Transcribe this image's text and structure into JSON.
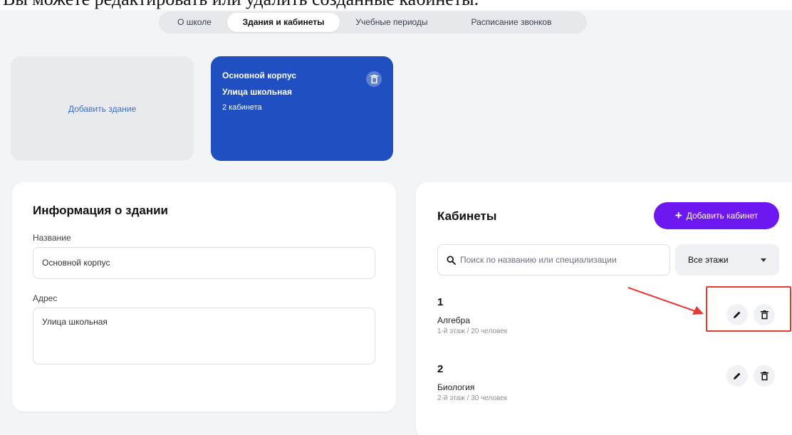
{
  "caption": "Вы можете редактировать или удалить созданные кабинеты.",
  "tabs": [
    {
      "label": "О школе",
      "active": false
    },
    {
      "label": "Здания и кабинеты",
      "active": true
    },
    {
      "label": "Учебные периоды",
      "active": false
    },
    {
      "label": "Расписание звонков",
      "active": false
    }
  ],
  "add_building_label": "Добавить здание",
  "building": {
    "name": "Основной корпус",
    "address": "Улица школьная",
    "rooms_count": "2 кабинета"
  },
  "info": {
    "title": "Информация о здании",
    "name_label": "Название",
    "name_value": "Основной корпус",
    "address_label": "Адрес",
    "address_value": "Улица школьная"
  },
  "rooms": {
    "title": "Кабинеты",
    "add_label": "Добавить кабинет",
    "search_placeholder": "Поиск по названию или специализации",
    "floor_filter": "Все этажи",
    "items": [
      {
        "number": "1",
        "subject": "Алгебра",
        "meta": "1-й этаж / 20 человек"
      },
      {
        "number": "2",
        "subject": "Биология",
        "meta": "2-й этаж / 30 человек"
      }
    ]
  },
  "colors": {
    "building_card": "#1f4fc1",
    "add_room_button": "#6d18f0",
    "highlight": "#e53935",
    "link": "#3b6fd4"
  }
}
